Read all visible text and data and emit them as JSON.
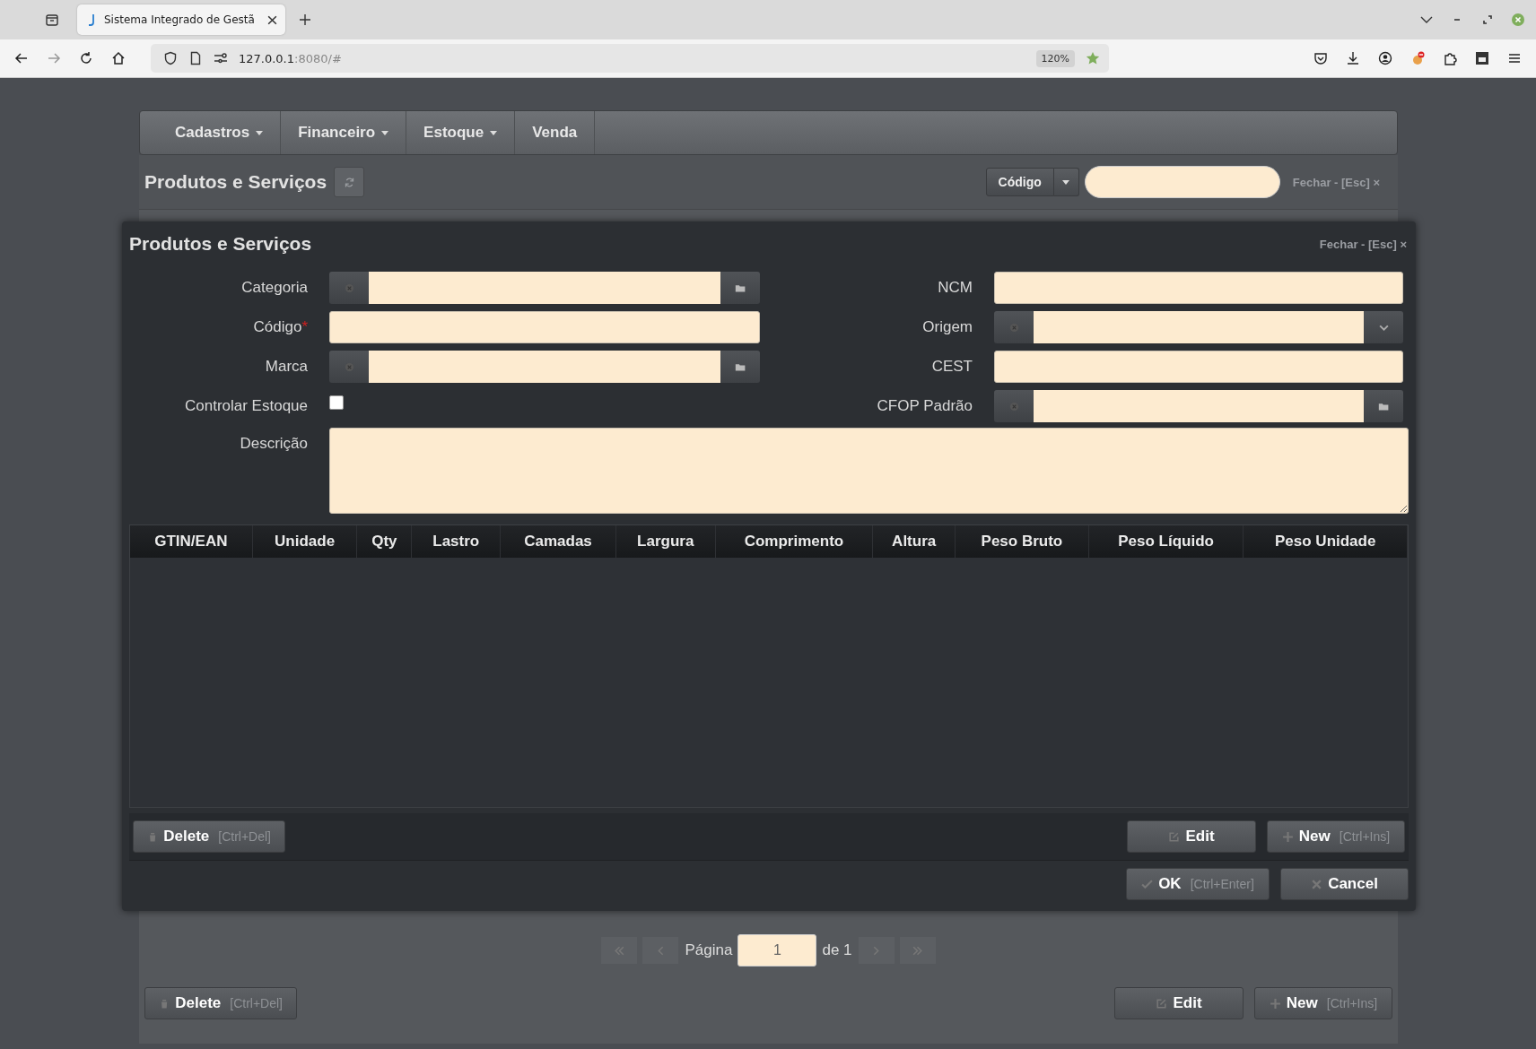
{
  "browser": {
    "tab_title": "Sistema Integrado de Gestã",
    "address_host": "127.0.0.1",
    "address_rest": ":8080/#",
    "zoom": "120%"
  },
  "nav": {
    "items": [
      {
        "label": "Cadastros",
        "dropdown": true
      },
      {
        "label": "Financeiro",
        "dropdown": true
      },
      {
        "label": "Estoque",
        "dropdown": true
      },
      {
        "label": "Venda",
        "dropdown": false
      }
    ]
  },
  "header": {
    "title": "Produtos e Serviços",
    "search_by": "Código",
    "close_link": "Fechar - [Esc] ×"
  },
  "modal": {
    "title": "Produtos e Serviços",
    "close_link": "Fechar - [Esc] ×",
    "left_fields": [
      {
        "label": "Categoria",
        "kind": "lookup"
      },
      {
        "label": "Código",
        "kind": "text",
        "marker": "*"
      },
      {
        "label": "Marca",
        "kind": "lookup"
      },
      {
        "label": "Controlar Estoque",
        "kind": "checkbox",
        "checked": false
      }
    ],
    "right_fields": [
      {
        "label": "NCM",
        "kind": "text"
      },
      {
        "label": "Origem",
        "kind": "select"
      },
      {
        "label": "CEST",
        "kind": "text"
      },
      {
        "label": "CFOP Padrão",
        "kind": "lookup"
      }
    ],
    "description_label": "Descrição",
    "table": {
      "columns": [
        "GTIN/EAN",
        "Unidade",
        "Qty",
        "Lastro",
        "Camadas",
        "Largura",
        "Comprimento",
        "Altura",
        "Peso Bruto",
        "Peso Líquido",
        "Peso Unidade"
      ]
    },
    "grid_buttons": [
      {
        "label": "Delete",
        "shortcut": "[Ctrl+Del]",
        "kind": "delete"
      },
      {
        "label": "Edit",
        "kind": "edit"
      },
      {
        "label": "New",
        "shortcut": "[Ctrl+Ins]",
        "kind": "new"
      }
    ],
    "footer_buttons": [
      {
        "label": "OK",
        "shortcut": "[Ctrl+Enter]",
        "kind": "ok"
      },
      {
        "label": "Cancel",
        "kind": "cancel"
      }
    ]
  },
  "pagination": {
    "label": "Página",
    "page": "1",
    "total": "de 1"
  },
  "bottom_buttons": [
    {
      "label": "Delete",
      "shortcut": "[Ctrl+Del]",
      "kind": "delete"
    },
    {
      "label": "Edit",
      "kind": "edit"
    },
    {
      "label": "New",
      "shortcut": "[Ctrl+Ins]",
      "kind": "new"
    }
  ]
}
